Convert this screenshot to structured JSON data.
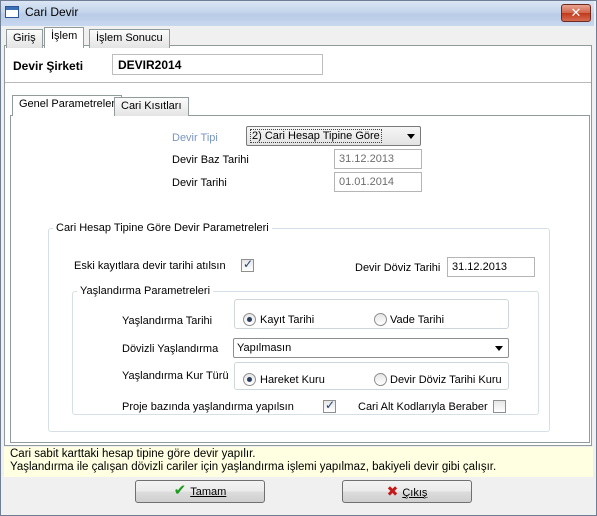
{
  "window": {
    "title": "Cari Devir",
    "close_glyph": "✕",
    "icon": "app-window-icon"
  },
  "top_tabs": [
    "Giriş",
    "İşlem",
    "İşlem Sonucu"
  ],
  "active_top_tab": "İşlem",
  "company": {
    "label": "Devir Şirketi",
    "value": "DEVIR2014"
  },
  "inner_tabs": [
    "Genel Parametreler",
    "Cari Kısıtları"
  ],
  "active_inner_tab": "Genel Parametreler",
  "general": {
    "devir_tipi_label": "Devir Tipi",
    "devir_tipi_value": "2) Cari Hesap Tipine Göre",
    "baz_tarihi_label": "Devir Baz Tarihi",
    "baz_tarihi_value": "31.12.2013",
    "devir_tarihi_label": "Devir Tarihi",
    "devir_tarihi_value": "01.01.2014"
  },
  "params_group": {
    "title": "Cari Hesap Tipine Göre Devir Parametreleri",
    "eski_kayit_label": "Eski kayıtlara devir tarihi atılsın",
    "eski_kayit_checked": true,
    "doviz_tarihi_label": "Devir Döviz Tarihi",
    "doviz_tarihi_value": "31.12.2013"
  },
  "aging_group": {
    "title": "Yaşlandırma Parametreleri",
    "tarih_label": "Yaşlandırma Tarihi",
    "tarih_options": [
      "Kayıt Tarihi",
      "Vade Tarihi"
    ],
    "tarih_selected": "Kayıt Tarihi",
    "dovizli_label": "Dövizli Yaşlandırma",
    "dovizli_value": "Yapılmasın",
    "kur_label": "Yaşlandırma Kur Türü",
    "kur_options": [
      "Hareket Kuru",
      "Devir Döviz Tarihi Kuru"
    ],
    "kur_selected": "Hareket Kuru",
    "proje_label": "Proje bazında yaşlandırma yapılsın",
    "proje_checked": true,
    "alt_kod_label": "Cari Alt Kodlarıyla Beraber",
    "alt_kod_checked": false
  },
  "info": {
    "line1": "Cari sabit karttaki hesap tipine göre devir yapılır.",
    "line2": "Yaşlandırma ile çalışan dövizli cariler için yaşlandırma işlemi yapılmaz, bakiyeli devir gibi çalışır."
  },
  "buttons": {
    "ok_label": "Tamam",
    "ok_icon": "green-checkmark-icon",
    "cancel_label": "Çıkış",
    "cancel_icon": "red-x-icon"
  },
  "colors": {
    "info_background": "#ffffe1",
    "disabled_label": "#7a96c2"
  }
}
